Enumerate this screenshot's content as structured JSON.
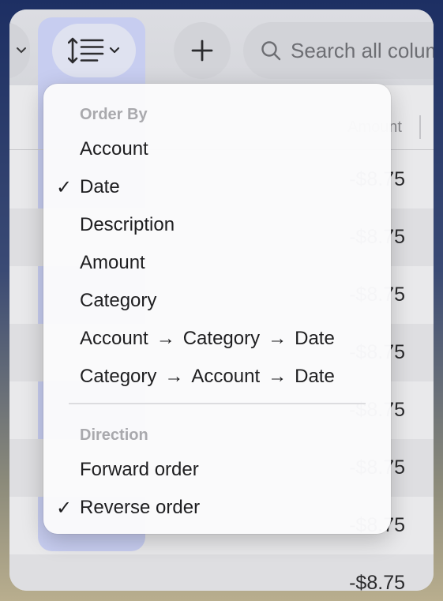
{
  "toolbar": {
    "search_placeholder": "Search all columns"
  },
  "table": {
    "amount_header": "Amount",
    "amounts": [
      "-$8.75",
      "-$8.75",
      "-$8.75",
      "-$8.75",
      "-$8.75",
      "-$8.75",
      "-$8.75",
      "-$8.75"
    ]
  },
  "menu": {
    "order_by_title": "Order By",
    "order_items": [
      {
        "label": "Account",
        "checked": false
      },
      {
        "label": "Date",
        "checked": true
      },
      {
        "label": "Description",
        "checked": false
      },
      {
        "label": "Amount",
        "checked": false
      },
      {
        "label": "Category",
        "checked": false
      }
    ],
    "combo_items": [
      {
        "parts": [
          "Account",
          "Category",
          "Date"
        ]
      },
      {
        "parts": [
          "Category",
          "Account",
          "Date"
        ]
      }
    ],
    "direction_title": "Direction",
    "direction_items": [
      {
        "label": "Forward order",
        "checked": false
      },
      {
        "label": "Reverse order",
        "checked": true
      }
    ],
    "check_glyph": "✓",
    "arrow_glyph": "→"
  }
}
